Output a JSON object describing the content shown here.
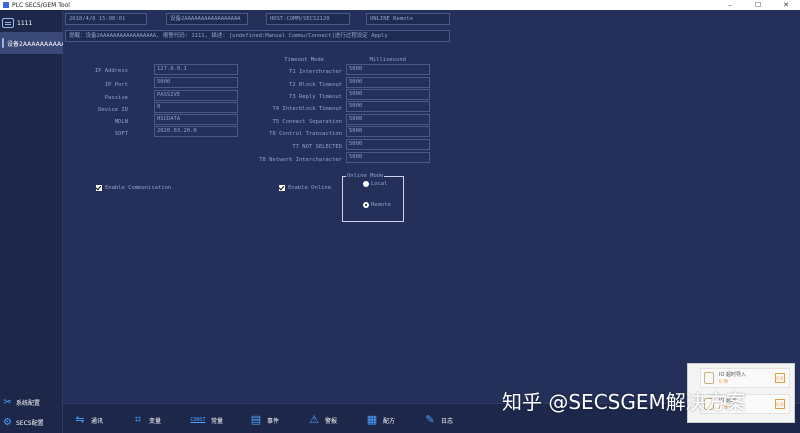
{
  "window": {
    "title": "PLC SECS/GEM Tool",
    "minimize": "–",
    "maximize": "☐",
    "close": "✕"
  },
  "sidebar": {
    "items": [
      {
        "label": "1111"
      },
      {
        "label": "设备2AAAAAAAAAA"
      }
    ],
    "bottom": [
      {
        "label": "系统配置",
        "icon": "tools-icon"
      },
      {
        "label": "SECS配置",
        "icon": "gear-icon"
      }
    ]
  },
  "info": {
    "date": "2018/4/8 15:00:01",
    "device": "设备2AAAAAAAAAAAAAAAAA",
    "host": "HOST:COMM/SECS2120",
    "status": "ONLINE Remote"
  },
  "warning": "提醒：设备2AAAAAAAAAAAAAAAAA, 报警代码: 1111, 描述: [undefined:Manual Commu/Connect]进行过程设定 Apply",
  "form": {
    "left": [
      {
        "label": "IP Address",
        "value": "127.0.0.1"
      },
      {
        "label": "IP Port",
        "value": "5000"
      },
      {
        "label": "Passive",
        "value": "PASSIVE"
      },
      {
        "label": "Device ID",
        "value": "0"
      },
      {
        "label": "MDLN",
        "value": "HSCDATA"
      },
      {
        "label": "SOFT",
        "value": "2020.03.20.0"
      }
    ],
    "mode_header": "Timeout Mode",
    "unit_header": "Millisecond",
    "right": [
      {
        "label": "T1 Interchracter",
        "value": "5000"
      },
      {
        "label": "T2 Block Timeout",
        "value": "5000"
      },
      {
        "label": "T3 Reply Timeout",
        "value": "5000"
      },
      {
        "label": "T4 Interblock Timeout",
        "value": "5000"
      },
      {
        "label": "T5 Connect Separation",
        "value": "5000"
      },
      {
        "label": "T6 Control Transaction",
        "value": "5000"
      },
      {
        "label": "T7 NOT SELECTED",
        "value": "5000"
      },
      {
        "label": "T8 Network Intercharacter",
        "value": "5000"
      }
    ],
    "enable_comm": "Enable Communication",
    "enable_online": "Enable Online",
    "online_mode": {
      "title": "Online Mode",
      "options": [
        "Local",
        "Remote"
      ],
      "selected": "Remote"
    }
  },
  "toolbar": [
    {
      "label": "通讯",
      "icon": "link-icon"
    },
    {
      "label": "变量",
      "icon": "variable-icon"
    },
    {
      "label": "常量",
      "icon": "const-icon",
      "icon_text": "CONST"
    },
    {
      "label": "事件",
      "icon": "event-icon"
    },
    {
      "label": "警报",
      "icon": "alarm-icon"
    },
    {
      "label": "配方",
      "icon": "recipe-icon"
    },
    {
      "label": "日志",
      "icon": "log-icon"
    }
  ],
  "popup": {
    "items": [
      {
        "title": "IO 超时导入",
        "sub": "0 项",
        "tag": "打开"
      },
      {
        "title": "IO 超时",
        "sub": "0 项",
        "tag": "打开"
      }
    ]
  },
  "watermark": "知乎 @SECSGEM解决方案"
}
